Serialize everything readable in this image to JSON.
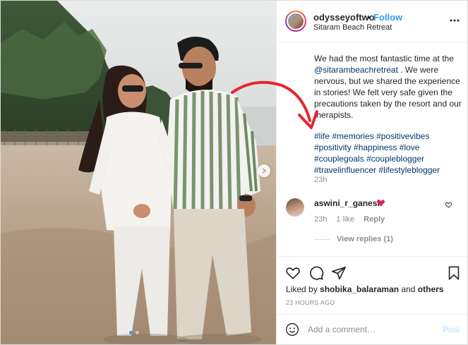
{
  "post": {
    "username": "odysseyoftwo",
    "bullet": "•",
    "follow_label": "Follow",
    "location": "Sitaram Beach Retreat",
    "more_icon": "more-horizontal-icon"
  },
  "caption": {
    "text_before": "We had the most fantastic time at the ",
    "mention": "@sitarambeachretreat",
    "text_after": " . We were nervous, but we shared the experience in stories! We felt very safe given the precautions taken by the resort and our therapists.",
    "hashtags": [
      "#life",
      "#memories",
      "#positivevibes",
      "#positivity",
      "#happiness",
      "#love",
      "#couplegoals",
      "#coupleblogger",
      "#travelinfluencer",
      "#lifestyleblogger"
    ],
    "time": "23h"
  },
  "comment": {
    "username": "aswini_r_ganesh",
    "emoji": "red-heart-emoji",
    "time": "23h",
    "likes": "1 like",
    "reply_label": "Reply",
    "view_replies": "View replies (1)"
  },
  "likes": {
    "prefix": "Liked by ",
    "user": "shobika_balaraman",
    "middle": " and ",
    "others": "others"
  },
  "timestamp": "23 HOURS AGO",
  "add_comment": {
    "placeholder": "Add a comment…",
    "post_label": "Post"
  },
  "carousel": {
    "total_slides": 2,
    "active_slide": 1
  },
  "colors": {
    "link_blue": "#3897f0",
    "hashtag": "#00376b",
    "muted": "#8e8e8e",
    "annotation_arrow": "#e4262f"
  }
}
